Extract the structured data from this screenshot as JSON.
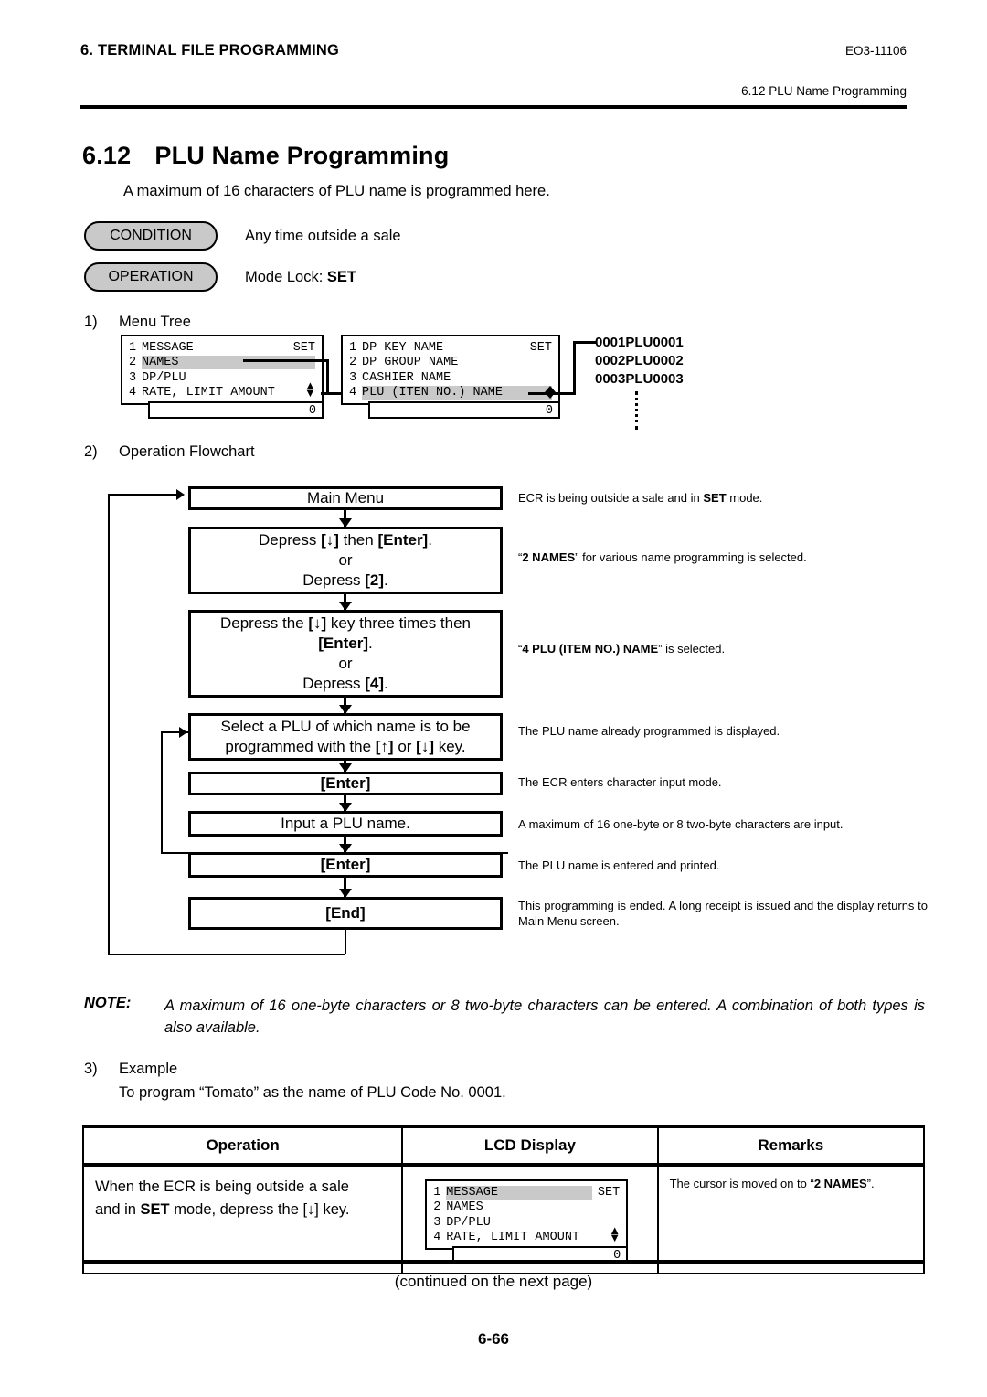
{
  "header": {
    "chapter": "6. TERMINAL FILE PROGRAMMING",
    "doc_code": "EO3-11106",
    "section_ref": "6.12 PLU Name Programming"
  },
  "title": {
    "number": "6.12",
    "text": "PLU Name Programming"
  },
  "intro": "A maximum of 16 characters of PLU name is programmed here.",
  "pills": {
    "condition_label": "CONDITION",
    "condition_text": "Any time outside a sale",
    "operation_label": "OPERATION",
    "operation_text_prefix": "Mode Lock: ",
    "operation_text_bold": "SET"
  },
  "steps": {
    "s1_num": "1)",
    "s1_text": "Menu Tree",
    "s2_num": "2)",
    "s2_text": "Operation Flowchart",
    "s3_num": "3)",
    "s3_text": "Example",
    "s3_detail": "To program “Tomato” as the name of PLU Code No. 0001."
  },
  "menu_tree": {
    "box1": {
      "rows": [
        {
          "idx": "1",
          "text": "MESSAGE",
          "right": "SET",
          "highlight": false
        },
        {
          "idx": "2",
          "text": "NAMES",
          "right": "",
          "highlight": true
        },
        {
          "idx": "3",
          "text": "DP/PLU",
          "right": "",
          "highlight": false
        },
        {
          "idx": "4",
          "text": "RATE, LIMIT AMOUNT",
          "right": "",
          "highlight": false
        }
      ],
      "footer": "0"
    },
    "box2": {
      "rows": [
        {
          "idx": "1",
          "text": "DP KEY NAME",
          "right": "SET",
          "highlight": false
        },
        {
          "idx": "2",
          "text": "DP GROUP NAME",
          "right": "",
          "highlight": false
        },
        {
          "idx": "3",
          "text": "CASHIER NAME",
          "right": "",
          "highlight": false
        },
        {
          "idx": "4",
          "text": "PLU (ITEN NO.) NAME",
          "right": "",
          "highlight": true
        }
      ],
      "footer": "0"
    },
    "plu_codes": [
      "0001PLU0001",
      "0002PLU0002",
      "0003PLU0003"
    ]
  },
  "flowchart": {
    "boxes": [
      {
        "id": "main-menu",
        "lines": [
          {
            "t": "Main Menu",
            "bold": false
          }
        ]
      },
      {
        "id": "depress-down-enter",
        "lines": [
          {
            "t": "Depress [↓] then [Enter].",
            "bold": false
          },
          {
            "t": "or",
            "bold": false
          },
          {
            "t": "Depress [2].",
            "bold": false
          }
        ]
      },
      {
        "id": "depress-three-times",
        "lines": [
          {
            "t": "Depress the [↓] key three times then",
            "bold": false
          },
          {
            "t": "[Enter].",
            "bold": false
          },
          {
            "t": "or",
            "bold": false
          },
          {
            "t": "Depress [4].",
            "bold": false
          }
        ]
      },
      {
        "id": "select-plu",
        "lines": [
          {
            "t": "Select a PLU of which name is to be",
            "bold": false
          },
          {
            "t": "programmed with the [↑] or [↓] key.",
            "bold": false
          }
        ]
      },
      {
        "id": "enter-1",
        "lines": [
          {
            "t": "[Enter]",
            "bold": true
          }
        ]
      },
      {
        "id": "input-plu-name",
        "lines": [
          {
            "t": "Input a PLU name.",
            "bold": false
          }
        ]
      },
      {
        "id": "enter-2",
        "lines": [
          {
            "t": "[Enter]",
            "bold": true
          }
        ]
      },
      {
        "id": "end",
        "lines": [
          {
            "t": "[End]",
            "bold": true
          }
        ]
      }
    ],
    "notes": [
      "ECR is being outside a sale and in SET mode.",
      "“2 NAMES” for various name programming is selected.",
      "“4 PLU (ITEM NO.) NAME” is selected.",
      "The PLU name already programmed is displayed.",
      "The ECR enters character input mode.",
      "A maximum of 16 one-byte or 8 two-byte characters are input.",
      "The PLU name is entered and printed.",
      "This programming is ended.  A long receipt is issued and the display returns to Main Menu screen."
    ]
  },
  "note": {
    "label": "NOTE:",
    "text": "A maximum of 16 one-byte characters or 8 two-byte characters can be entered.  A combination of both types is also available."
  },
  "table": {
    "headers": [
      "Operation",
      "LCD Display",
      "Remarks"
    ],
    "rows": [
      {
        "operation_line1": "When the ECR is being outside a sale",
        "operation_line2_pre": "and in ",
        "operation_line2_bold": "SET",
        "operation_line2_post": " mode, depress the [↓] key.",
        "lcd": {
          "rows": [
            {
              "idx": "1",
              "text": "MESSAGE",
              "right": "SET",
              "highlight": true
            },
            {
              "idx": "2",
              "text": "NAMES",
              "right": "",
              "highlight": false
            },
            {
              "idx": "3",
              "text": "DP/PLU",
              "right": "",
              "highlight": false
            },
            {
              "idx": "4",
              "text": "RATE, LIMIT AMOUNT",
              "right": "",
              "highlight": false
            }
          ],
          "footer": "0"
        },
        "remarks_pre": "The cursor is moved on to “",
        "remarks_bold": "2 NAMES",
        "remarks_post": "”."
      }
    ]
  },
  "footer": {
    "continued": "(continued on the next page)",
    "page_number": "6-66"
  }
}
